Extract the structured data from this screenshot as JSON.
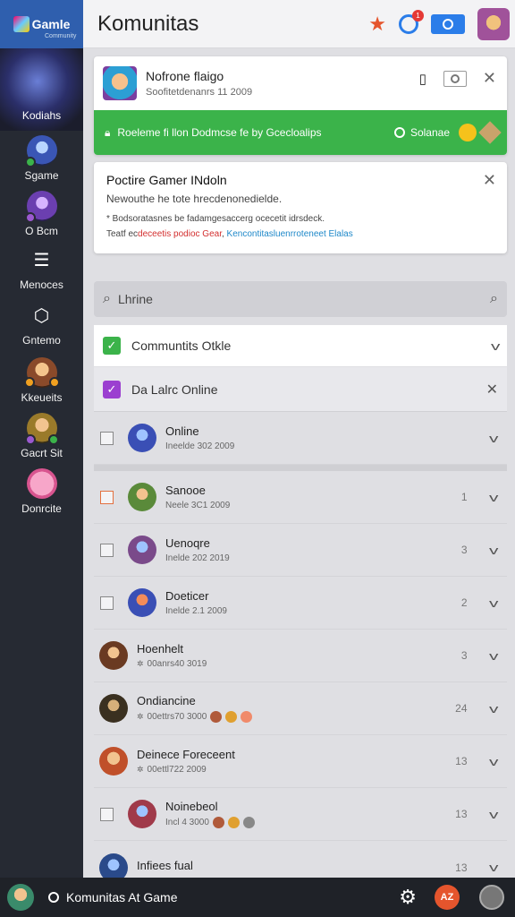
{
  "colors": {
    "accent": "#3bb34a",
    "brand": "#2f5fae",
    "badge": "#e53935"
  },
  "sidebar": {
    "brand_name": "Gamle",
    "brand_sub": "Community",
    "hero_label": "Kodiahs",
    "items": [
      {
        "label": "Sgame"
      },
      {
        "label": "O Bcm"
      },
      {
        "label": "Menoces"
      },
      {
        "label": "Gntemo"
      },
      {
        "label": "Kkeueits"
      },
      {
        "label": "Gacrt Sit"
      },
      {
        "label": "Donrcite"
      }
    ]
  },
  "header": {
    "title": "Komunitas",
    "notification_count": "1"
  },
  "notification": {
    "name": "Nofrone flaigo",
    "subtitle": "Soofitetdenanrs 11 2009",
    "bar_message": "Roeleme fi llon Dodmcse fe by Gcecloalips",
    "source_label": "Solanae"
  },
  "info": {
    "title": "Poctire Gamer INdoln",
    "desc": "Newouthe he tote hrecdenonedielde.",
    "line1": "* Bodsoratasnes be fadamgesaccerg ocecetit idrsdeck.",
    "line2_a": "Teatf ec",
    "line2_red": "deceetis podioc Gear",
    "line2_b": ", ",
    "line2_blue": "Kencontitasluenrroteneet Elalas"
  },
  "search": {
    "value": "Lhrine"
  },
  "groups": [
    {
      "label": "Communtits Otkle"
    },
    {
      "label": "Da Lalrc Online"
    }
  ],
  "rows": [
    {
      "name": "Online",
      "meta": "Ineelde 302 2009",
      "count": ""
    },
    {
      "name": "Sanooe",
      "meta": "Neele 3C1 2009",
      "count": "1"
    },
    {
      "name": "Uenoqre",
      "meta": "Inelde 202 2019",
      "count": "3"
    },
    {
      "name": "Doeticer",
      "meta": "Inelde 2.1 2009",
      "count": "2"
    },
    {
      "name": "Hoenhelt",
      "meta": "00anrs40 3019",
      "count": "3"
    },
    {
      "name": "Ondiancine",
      "meta": "00ettrs70 3000",
      "count": "24"
    },
    {
      "name": "Deinece Foreceent",
      "meta": "00ettl722 2009",
      "count": "13"
    },
    {
      "name": "Noinebeol",
      "meta": "Incl 4 3000",
      "count": "13"
    },
    {
      "name": "Infiees fual",
      "meta": "",
      "count": "13"
    }
  ],
  "bottom": {
    "title": "Komunitas At Game",
    "badge": "AZ"
  }
}
